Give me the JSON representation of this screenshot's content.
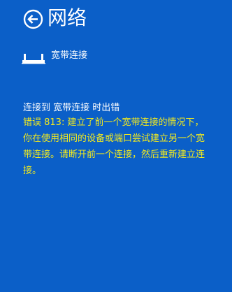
{
  "header": {
    "back_icon": "back-arrow-icon",
    "title": "网络"
  },
  "connection": {
    "icon": "broadband-connection-icon",
    "label": "宽带连接"
  },
  "error": {
    "heading": "连接到 宽带连接 时出错",
    "message": "错误 813: 建立了前一个宽带连接的情况下，你在使用相同的设备或端口尝试建立另一个宽带连接。请断开前一个连接，然后重新建立连接。",
    "color": "#f2ea1e"
  },
  "colors": {
    "background": "#0b5fc8",
    "text": "#ffffff"
  }
}
